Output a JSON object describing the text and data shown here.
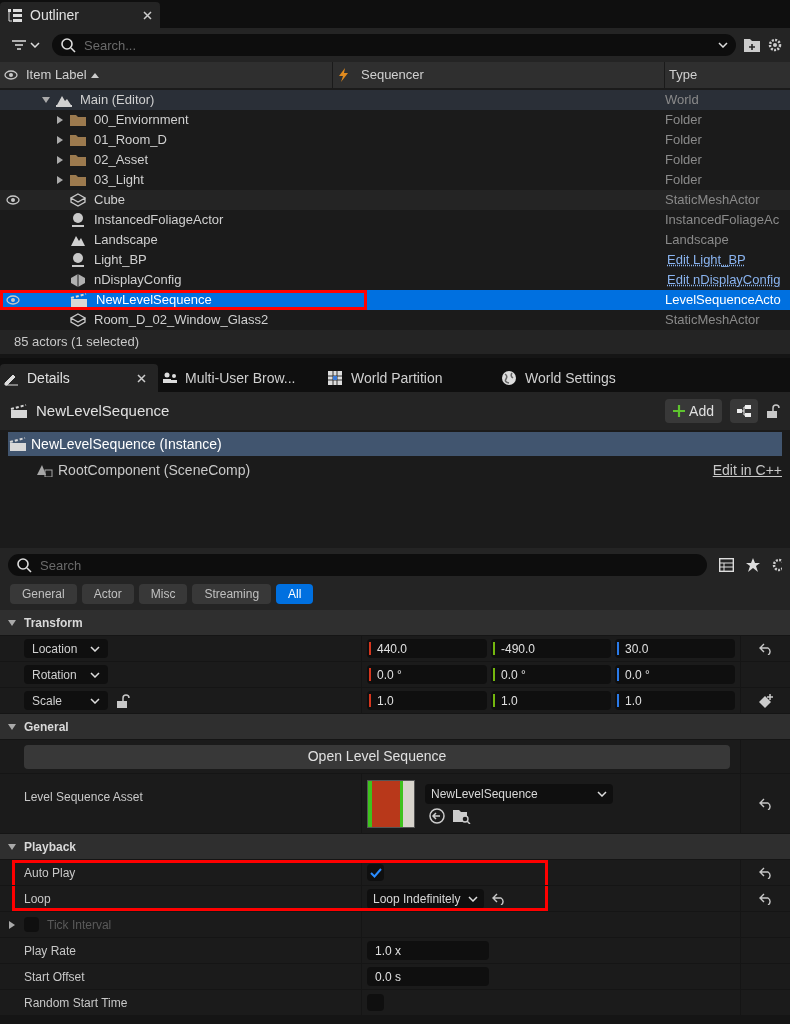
{
  "outliner": {
    "tab": {
      "label": "Outliner"
    },
    "search": {
      "placeholder": "Search..."
    },
    "columns": [
      {
        "label": "Item Label"
      },
      {
        "label": "Sequencer"
      },
      {
        "label": "Type"
      }
    ],
    "rows": [
      {
        "kind": "world",
        "label": "Main (Editor)",
        "type": "World",
        "visible": false,
        "selected": false,
        "expanded": true,
        "annotated": false,
        "children": [
          {
            "kind": "folder",
            "label": "00_Enviornment",
            "type": "Folder",
            "visible": false,
            "selected": false,
            "expanded": false,
            "annotated": false
          },
          {
            "kind": "folder",
            "label": "01_Room_D",
            "type": "Folder",
            "visible": false,
            "selected": false,
            "expanded": false,
            "annotated": false
          },
          {
            "kind": "folder",
            "label": "02_Asset",
            "type": "Folder",
            "visible": false,
            "selected": false,
            "expanded": false,
            "annotated": false
          },
          {
            "kind": "folder",
            "label": "03_Light",
            "type": "Folder",
            "visible": false,
            "selected": false,
            "expanded": false,
            "annotated": false
          },
          {
            "kind": "mesh",
            "label": "Cube",
            "type": "StaticMeshActor",
            "visible": true,
            "selected": false,
            "annotated": false
          },
          {
            "kind": "sphere",
            "label": "InstancedFoliageActor",
            "type": "InstancedFoliageAc",
            "visible": false,
            "selected": false,
            "annotated": false
          },
          {
            "kind": "landscape",
            "label": "Landscape",
            "type": "Landscape",
            "visible": false,
            "selected": false,
            "annotated": false
          },
          {
            "kind": "sphere",
            "label": "Light_BP",
            "type": "Edit Light_BP",
            "type_link": true,
            "visible": false,
            "selected": false,
            "annotated": false
          },
          {
            "kind": "cube",
            "label": "nDisplayConfig",
            "type": "Edit nDisplayConfig",
            "type_link": true,
            "visible": false,
            "selected": false,
            "annotated": false
          },
          {
            "kind": "sequence",
            "label": "NewLevelSequence",
            "type": "LevelSequenceActo",
            "visible": true,
            "selected": true,
            "annotated": true
          },
          {
            "kind": "mesh",
            "label": "Room_D_02_Window_Glass2",
            "type": "StaticMeshActor",
            "visible": false,
            "selected": false,
            "annotated": false
          }
        ]
      }
    ],
    "status": "85 actors (1 selected)"
  },
  "details": {
    "tabs": [
      {
        "label": "Details",
        "selected": true,
        "kind": "details"
      },
      {
        "label": "Multi-User Brow...",
        "selected": false,
        "kind": "users"
      },
      {
        "label": "World Partition",
        "selected": false,
        "kind": "grid"
      },
      {
        "label": "World Settings",
        "selected": false,
        "kind": "globe"
      }
    ],
    "actor_name": "NewLevelSequence",
    "add_button": "Add",
    "components": [
      {
        "label": "NewLevelSequence (Instance)",
        "selected": true,
        "kind": "sequence"
      },
      {
        "label": "RootComponent (SceneComp)",
        "selected": false,
        "kind": "scene",
        "link": "Edit in C++"
      }
    ],
    "search": {
      "placeholder": "Search"
    },
    "filters": [
      {
        "label": "General",
        "selected": false
      },
      {
        "label": "Actor",
        "selected": false
      },
      {
        "label": "Misc",
        "selected": false
      },
      {
        "label": "Streaming",
        "selected": false
      },
      {
        "label": "All",
        "selected": true
      }
    ],
    "sections": [
      {
        "title": "Transform",
        "expanded": true,
        "rows": [
          {
            "kind": "vector",
            "label": "Location",
            "values": [
              "440.0",
              "-490.0",
              "30.0"
            ],
            "resettable": true,
            "annotated": false
          },
          {
            "kind": "vector",
            "label": "Rotation",
            "values": [
              "0.0 °",
              "0.0 °",
              "0.0 °"
            ],
            "resettable": false,
            "annotated": false
          },
          {
            "kind": "vector",
            "label": "Scale",
            "values": [
              "1.0",
              "1.0",
              "1.0"
            ],
            "resettable": false,
            "lock": true,
            "annotated": false
          }
        ]
      },
      {
        "title": "General",
        "expanded": true,
        "rows": [
          {
            "kind": "button",
            "label": "Open Level Sequence",
            "annotated": false
          },
          {
            "kind": "asset",
            "label": "Level Sequence Asset",
            "value": "NewLevelSequence",
            "resettable": true,
            "annotated": false
          }
        ]
      },
      {
        "title": "Playback",
        "expanded": true,
        "rows": [
          {
            "kind": "checkbox",
            "label": "Auto Play",
            "checked": true,
            "resettable": true,
            "annotated": true
          },
          {
            "kind": "dropdown",
            "label": "Loop",
            "value": "Loop Indefinitely",
            "resettable": true,
            "annotated": true
          },
          {
            "kind": "group",
            "label": "Tick Interval",
            "disabled": true,
            "expanded": false,
            "checked": false,
            "annotated": false
          },
          {
            "kind": "text",
            "label": "Play Rate",
            "value": "1.0 x",
            "annotated": false
          },
          {
            "kind": "text",
            "label": "Start Offset",
            "value": "0.0 s",
            "annotated": false
          },
          {
            "kind": "checkbox",
            "label": "Random Start Time",
            "checked": false,
            "resettable": false,
            "annotated": false
          }
        ]
      }
    ]
  }
}
